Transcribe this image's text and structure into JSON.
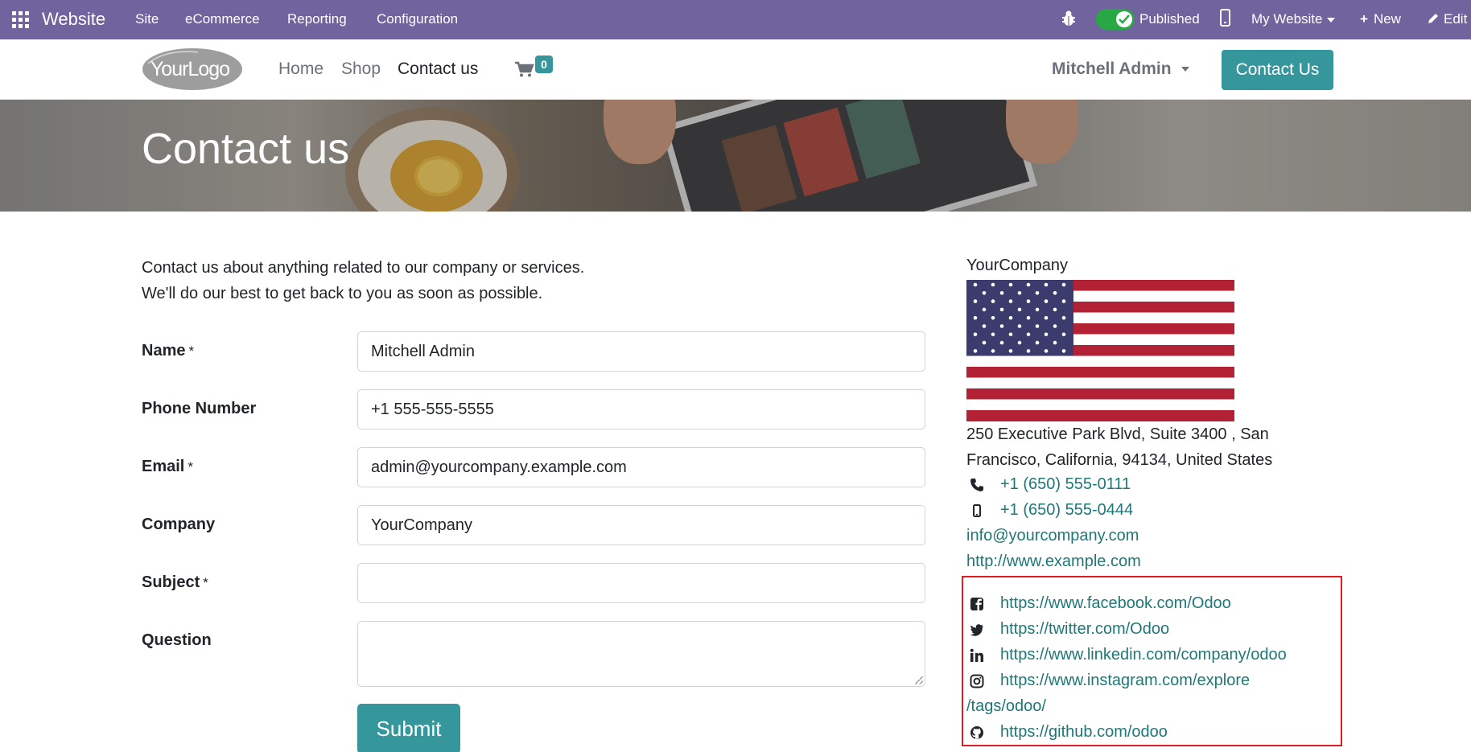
{
  "admin_bar": {
    "app_name": "Website",
    "menus": [
      "Site",
      "eCommerce",
      "Reporting",
      "Configuration"
    ],
    "published_label": "Published",
    "published": true,
    "website_label": "My Website",
    "new_label": "New",
    "edit_label": "Edit"
  },
  "header": {
    "logo_text": "YourLogo",
    "nav": [
      "Home",
      "Shop",
      "Contact us"
    ],
    "active_nav": "Contact us",
    "cart_count": "0",
    "user_name": "Mitchell Admin",
    "cta_label": "Contact Us"
  },
  "banner": {
    "title": "Contact us"
  },
  "intro": {
    "line1": "Contact us about anything related to our company or services.",
    "line2": "We'll do our best to get back to you as soon as possible."
  },
  "form": {
    "fields": [
      {
        "label": "Name",
        "required": "*",
        "value": "Mitchell Admin"
      },
      {
        "label": "Phone Number",
        "required": "",
        "value": "+1 555-555-5555"
      },
      {
        "label": "Email",
        "required": "*",
        "value": "admin@yourcompany.example.com"
      },
      {
        "label": "Company",
        "required": "",
        "value": "YourCompany"
      },
      {
        "label": "Subject",
        "required": "*",
        "value": ""
      },
      {
        "label": "Question",
        "required": "",
        "value": ""
      }
    ],
    "submit_label": "Submit"
  },
  "company": {
    "name": "YourCompany",
    "address_line1": "250 Executive Park Blvd, Suite 3400 , San",
    "address_line2": "Francisco, California, 94134, United States",
    "phone": "+1 (650) 555-0111",
    "mobile": "+1 (650) 555-0444",
    "email": "info@yourcompany.com",
    "website": "http://www.example.com"
  },
  "social": {
    "facebook": "https://www.facebook.com/Odoo",
    "twitter": "https://twitter.com/Odoo",
    "linkedin": "https://www.linkedin.com/company/odoo",
    "instagram_line1": "https://www.instagram.com/explore",
    "instagram_line2": "/tags/odoo/",
    "github": "https://github.com/odoo"
  },
  "colors": {
    "admin_bar": "#71639e",
    "primary": "#35979c",
    "link": "#1e7878",
    "highlight_box": "#e11d24"
  }
}
